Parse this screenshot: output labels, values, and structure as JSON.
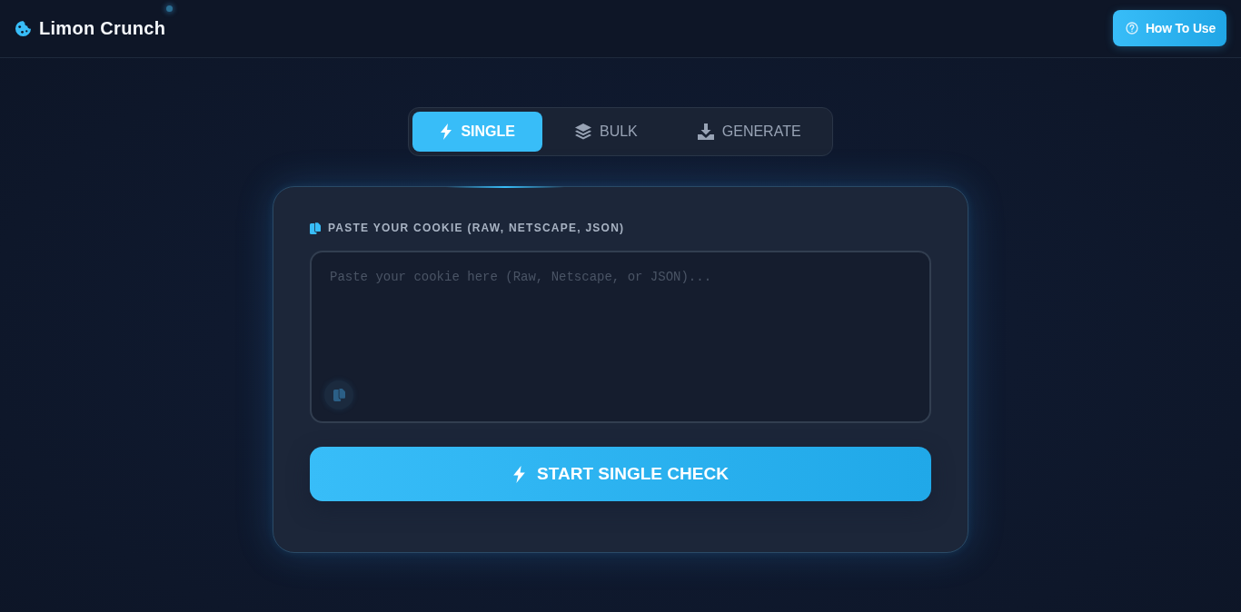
{
  "header": {
    "logo": "Limon Crunch",
    "help_button": "How To Use"
  },
  "tabs": [
    {
      "label": "SINGLE",
      "selected": true
    },
    {
      "label": "BULK",
      "selected": false
    },
    {
      "label": "GENERATE",
      "selected": false
    }
  ],
  "input": {
    "label": "PASTE YOUR COOKIE (RAW, NETSCAPE, JSON)",
    "placeholder": "Paste your cookie here (Raw, Netscape, or JSON)..."
  },
  "action_button": "START SINGLE CHECK"
}
